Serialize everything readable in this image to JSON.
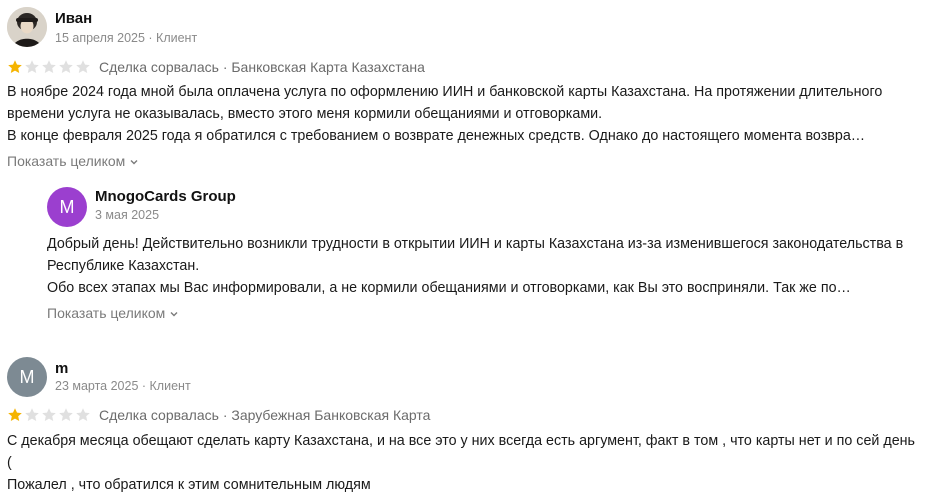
{
  "reviews": [
    {
      "author": "Иван",
      "meta": "15 апреля 2025 · Клиент",
      "rating": 1,
      "deal": "Сделка сорвалась · Банковская Карта Казахстана",
      "lines": [
        "В ноябре 2024 года мной была оплачена услуга по оформлению ИИН и банковской карты Казахстана. На протяжении длительного времени услуга не оказывалась, вместо этого меня кормили обещаниями и отговорками.",
        "В конце февраля 2025 года я обратился с требованием о возврате денежных средств. Однако до настоящего момента возвра…"
      ],
      "expand_label": "Показать целиком",
      "reply": {
        "avatar_letter": "M",
        "author": "MnogoCards Group",
        "date": "3 мая 2025",
        "lines": [
          "Добрый день! Действительно возникли трудности в открытии ИИН и карты Казахстана из-за изменившегося законодательства в Республике Казахстан.",
          "Обо всех этапах мы Вас информировали, а не кормили обещаниями и отговорками, как Вы это восприняли. Так же по…"
        ],
        "expand_label": "Показать целиком"
      }
    },
    {
      "avatar_letter": "M",
      "author": "m",
      "meta": "23 марта 2025 · Клиент",
      "rating": 1,
      "deal": "Сделка сорвалась · Зарубежная Банковская Карта",
      "lines": [
        "С декабря месяца обещают сделать карту Казахстана, и на все это у них всегда есть аргумент, факт в том , что карты нет и по сей день (",
        "Пожалел , что обратился к этим сомнительным людям"
      ]
    }
  ],
  "colors": {
    "star_filled": "#f5b400",
    "star_empty": "#e0e0e0",
    "reply_avatar": "#9b3fcf",
    "user_avatar": "#7d8a93"
  }
}
